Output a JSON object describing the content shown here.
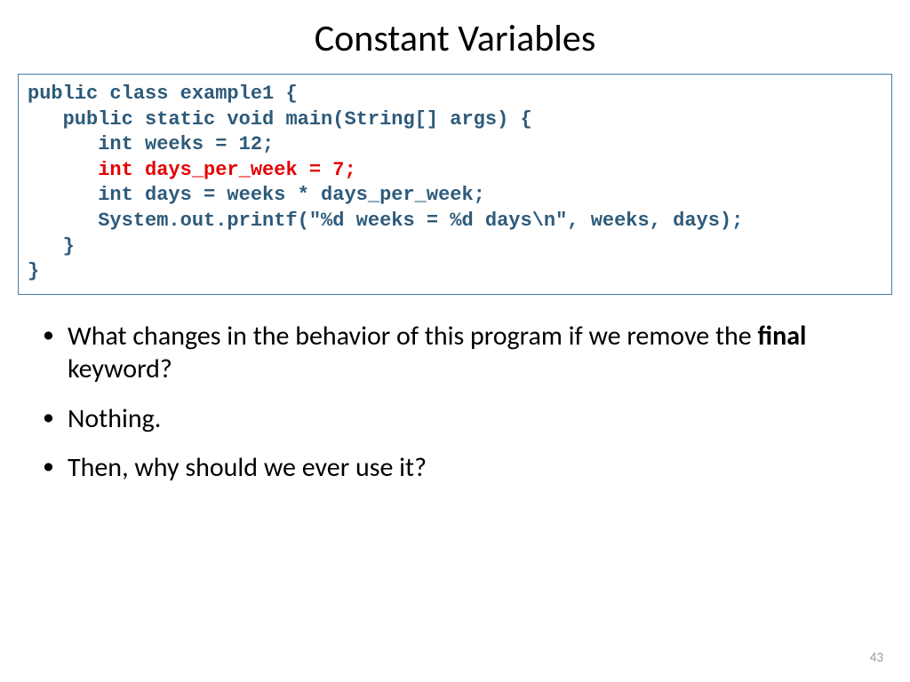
{
  "title": "Constant Variables",
  "code": {
    "line1": "public class example1 {",
    "line2": "   public static void main(String[] args) {",
    "line3": "      int weeks = 12;",
    "line4": "      int days_per_week = 7;",
    "line5": "      int days = weeks * days_per_week;",
    "line6": "      System.out.printf(\"%d weeks = %d days\\n\", weeks, days);",
    "line7": "   }",
    "line8": "}"
  },
  "bullets": {
    "b1_pre": "What changes in the behavior of this program if we remove the ",
    "b1_bold": "final",
    "b1_post": " keyword?",
    "b2": "Nothing.",
    "b3": "Then, why should we ever use it?"
  },
  "page_number": "43"
}
